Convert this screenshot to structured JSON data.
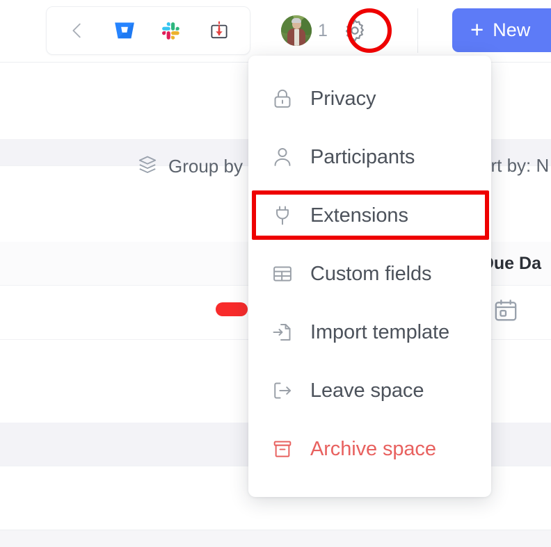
{
  "toolbar": {
    "icons": [
      {
        "name": "back-chevron-icon",
        "label": "Back"
      },
      {
        "name": "bitbucket-icon",
        "label": "Bitbucket"
      },
      {
        "name": "slack-icon",
        "label": "Slack"
      },
      {
        "name": "import-download-icon",
        "label": "Import"
      }
    ],
    "member_count": "1",
    "gear_label": "Settings",
    "new_button": {
      "plus": "+",
      "label": "New"
    }
  },
  "filterbar": {
    "group_by": "Group by",
    "sort_by": "ort by: N"
  },
  "table": {
    "due_date_header": "Due Da"
  },
  "menu": {
    "items": [
      {
        "icon": "lock-icon",
        "label": "Privacy",
        "danger": false
      },
      {
        "icon": "person-icon",
        "label": "Participants",
        "danger": false
      },
      {
        "icon": "plug-icon",
        "label": "Extensions",
        "danger": false
      },
      {
        "icon": "table-grid-icon",
        "label": "Custom fields",
        "danger": false
      },
      {
        "icon": "file-import-icon",
        "label": "Import template",
        "danger": false
      },
      {
        "icon": "exit-arrow-icon",
        "label": "Leave space",
        "danger": false
      },
      {
        "icon": "archive-box-icon",
        "label": "Archive space",
        "danger": true
      }
    ]
  },
  "annotations": {
    "highlight_color": "#ee0000",
    "highlighted_menu_item": "Extensions",
    "highlighted_toolbar_item": "Settings"
  },
  "colors": {
    "accent_blue": "#5d7bf7",
    "danger_red": "#e8615f",
    "pill_red": "#f82b2b",
    "menu_text": "#4c525b"
  }
}
